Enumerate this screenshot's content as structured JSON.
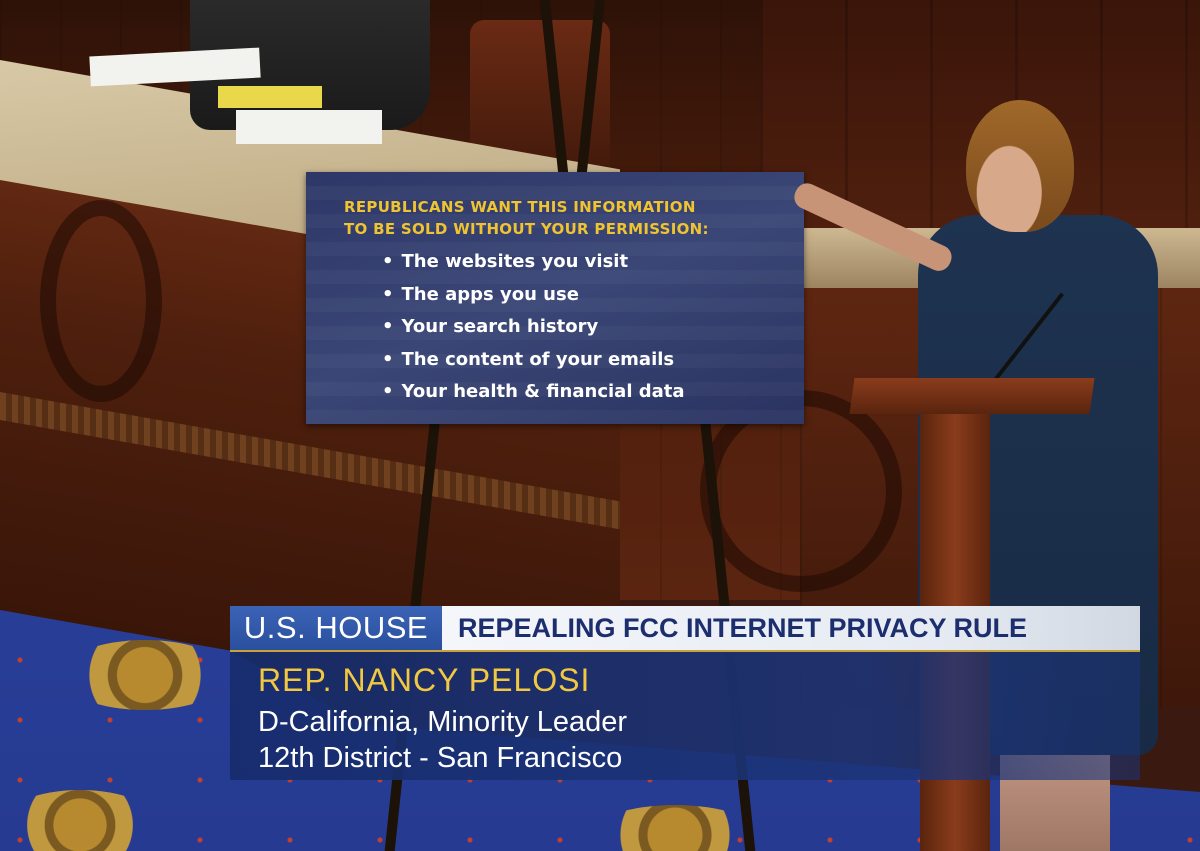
{
  "sign": {
    "headline": [
      "REPUBLICANS WANT THIS INFORMATION",
      "TO BE SOLD WITHOUT YOUR PERMISSION:"
    ],
    "items": [
      "The websites you visit",
      "The apps you use",
      "Your search history",
      "The content of your emails",
      "Your health & financial data"
    ]
  },
  "lower_third": {
    "label": "U.S. HOUSE",
    "topic": "REPEALING FCC INTERNET PRIVACY RULE",
    "name": "REP. NANCY PELOSI",
    "line1": "D-California, Minority Leader",
    "line2": "12th District - San Francisco"
  },
  "colors": {
    "sign_headline": "#f0c430",
    "sign_background": "#2e3868",
    "lower_third_label_bg": "#2a4f9e",
    "lower_third_name": "#f2c842"
  }
}
